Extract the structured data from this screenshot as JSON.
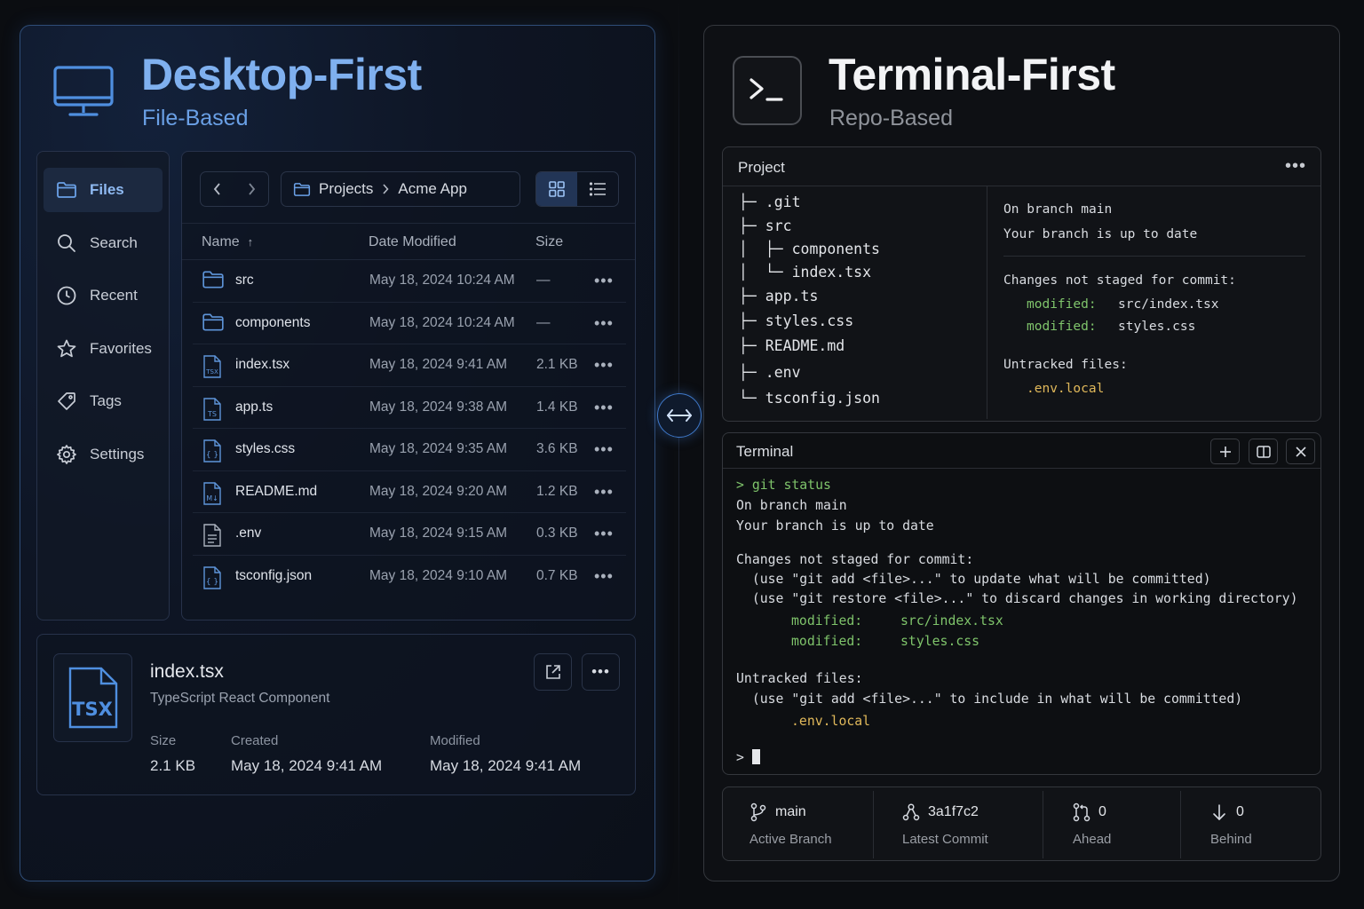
{
  "left": {
    "title": "Desktop-First",
    "subtitle": "File-Based",
    "sidebar": {
      "items": [
        {
          "label": "Files",
          "icon": "folder-icon",
          "active": true
        },
        {
          "label": "Search",
          "icon": "search-icon"
        },
        {
          "label": "Recent",
          "icon": "clock-icon"
        },
        {
          "label": "Favorites",
          "icon": "star-icon"
        },
        {
          "label": "Tags",
          "icon": "tag-icon"
        },
        {
          "label": "Settings",
          "icon": "gear-icon"
        }
      ]
    },
    "breadcrumb": {
      "root": "Projects",
      "current": "Acme App"
    },
    "columns": {
      "name": "Name",
      "date": "Date Modified",
      "size": "Size"
    },
    "files": [
      {
        "name": "src",
        "icon": "folder-icon",
        "date": "May 18, 2024  10:24 AM",
        "size": "—"
      },
      {
        "name": "components",
        "icon": "folder-icon",
        "date": "May 18, 2024  10:24 AM",
        "size": "—"
      },
      {
        "name": "index.tsx",
        "icon": "tsx-file-icon",
        "date": "May 18, 2024  9:41 AM",
        "size": "2.1 KB"
      },
      {
        "name": "app.ts",
        "icon": "ts-file-icon",
        "date": "May 18, 2024  9:38 AM",
        "size": "1.4 KB"
      },
      {
        "name": "styles.css",
        "icon": "css-file-icon",
        "date": "May 18, 2024  9:35 AM",
        "size": "3.6 KB"
      },
      {
        "name": "README.md",
        "icon": "markdown-file-icon",
        "date": "May 18, 2024  9:20 AM",
        "size": "1.2 KB"
      },
      {
        "name": ".env",
        "icon": "text-file-icon",
        "date": "May 18, 2024  9:15 AM",
        "size": "0.3 KB"
      },
      {
        "name": "tsconfig.json",
        "icon": "json-file-icon",
        "date": "May 18, 2024  9:10 AM",
        "size": "0.7 KB"
      }
    ],
    "detail": {
      "name": "index.tsx",
      "type": "TypeScript React Component",
      "badge": "TSX",
      "size_label": "Size",
      "size": "2.1 KB",
      "created_label": "Created",
      "created": "May 18, 2024 9:41 AM",
      "modified_label": "Modified",
      "modified": "May 18, 2024 9:41 AM"
    }
  },
  "right": {
    "title": "Terminal-First",
    "subtitle": "Repo-Based",
    "project": {
      "title": "Project",
      "tree": [
        "├─ .git",
        "├─ src",
        "│  ├─ components",
        "│  └─ index.tsx",
        "├─ app.ts",
        "├─ styles.css",
        "├─ README.md",
        "├─ .env",
        "└─ tsconfig.json"
      ],
      "status": {
        "branch": "On branch main",
        "uptodate": "Your branch is up to date",
        "not_staged": "Changes not staged for commit:",
        "mod_label": "modified:",
        "mod1": "src/index.tsx",
        "mod2": "styles.css",
        "untracked": "Untracked files:",
        "untracked_file": ".env.local"
      }
    },
    "terminal": {
      "title": "Terminal",
      "command": "> git status",
      "line1": "On branch main",
      "line2": "Your branch is up to date",
      "line3": "Changes not staged for commit:",
      "hint1": "  (use \"git add <file>...\" to update what will be committed)",
      "hint2": "  (use \"git restore <file>...\" to discard changes in working directory)",
      "mod_label": "modified:",
      "mod1": "src/index.tsx",
      "mod2": "styles.css",
      "line4": "Untracked files:",
      "hint3": "  (use \"git add <file>...\" to include in what will be committed)",
      "untracked_file": ".env.local",
      "prompt": ">"
    },
    "stats": [
      {
        "value": "main",
        "label": "Active Branch",
        "icon": "branch-icon"
      },
      {
        "value": "3a1f7c2",
        "label": "Latest Commit",
        "icon": "commit-icon"
      },
      {
        "value": "0",
        "label": "Ahead",
        "icon": "pull-request-icon"
      },
      {
        "value": "0",
        "label": "Behind",
        "icon": "arrow-down-icon"
      }
    ]
  }
}
